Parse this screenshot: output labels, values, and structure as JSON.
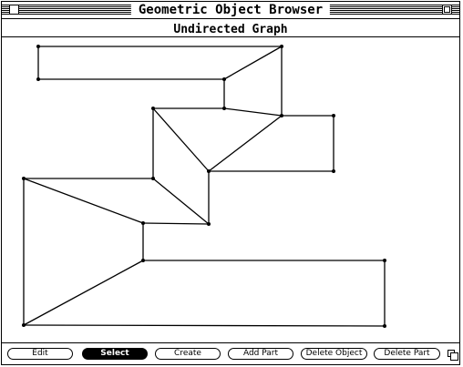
{
  "window": {
    "title": "Geometric Object Browser",
    "subtitle": "Undirected Graph"
  },
  "toolbar": {
    "buttons": [
      {
        "label": "Edit",
        "selected": false
      },
      {
        "label": "Select",
        "selected": true
      },
      {
        "label": "Create",
        "selected": false
      },
      {
        "label": "Add Part",
        "selected": false
      },
      {
        "label": "Delete Object",
        "selected": false
      },
      {
        "label": "Delete Part",
        "selected": false
      }
    ]
  },
  "icons": {
    "close": "close-box-icon",
    "zoom": "zoom-box-icon",
    "grow": "size-box-icon"
  },
  "colors": {
    "foreground": "#000000",
    "background": "#ffffff"
  }
}
